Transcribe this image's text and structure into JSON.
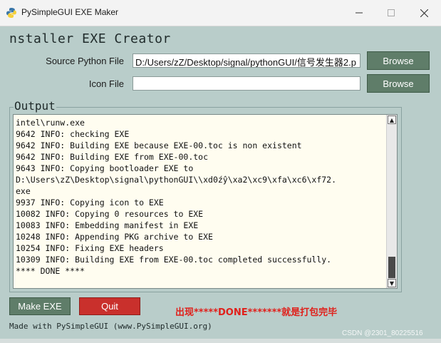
{
  "window": {
    "title": "PySimpleGUI EXE Maker",
    "app_icon": "python-logo-icon",
    "controls": [
      "minimize-icon",
      "maximize-icon",
      "close-icon"
    ]
  },
  "header": {
    "text": "nstaller EXE Creator"
  },
  "form": {
    "source_label": "Source Python File",
    "source_value": "D:/Users/zZ/Desktop/signal/pythonGUI/信号发生器2.p",
    "icon_label": "Icon File",
    "icon_value": "",
    "browse_label": "Browse"
  },
  "output": {
    "title": "Output",
    "lines": [
      "intel\\runw.exe",
      "9642 INFO: checking EXE",
      "9642 INFO: Building EXE because EXE-00.toc is non existent",
      "9642 INFO: Building EXE from EXE-00.toc",
      "9643 INFO: Copying bootloader EXE to",
      "D:\\Users\\zZ\\Desktop\\signal\\pythonGUI\\\\xd0źŷ\\xa2\\xc9\\xfa\\xc6\\xf72.",
      "exe",
      "9937 INFO: Copying icon to EXE",
      "10082 INFO: Copying 0 resources to EXE",
      "10083 INFO: Embedding manifest in EXE",
      "10248 INFO: Appending PKG archive to EXE",
      "10254 INFO: Fixing EXE headers",
      "10309 INFO: Building EXE from EXE-00.toc completed successfully.",
      "**** DONE ****"
    ]
  },
  "buttons": {
    "make_exe": "Make EXE",
    "quit": "Quit"
  },
  "annotation": {
    "text": "出现*****DONE*******就是打包完毕",
    "color": "#e0201b"
  },
  "footer": {
    "text": "Made with PySimpleGUI (www.PySimpleGUI.org)"
  },
  "watermark": {
    "text": "CSDN @2301_80225516"
  },
  "colors": {
    "background": "#b9cdca",
    "button": "#5f7d69",
    "quit_button": "#c9302c",
    "output_bg": "#fffdf0"
  }
}
